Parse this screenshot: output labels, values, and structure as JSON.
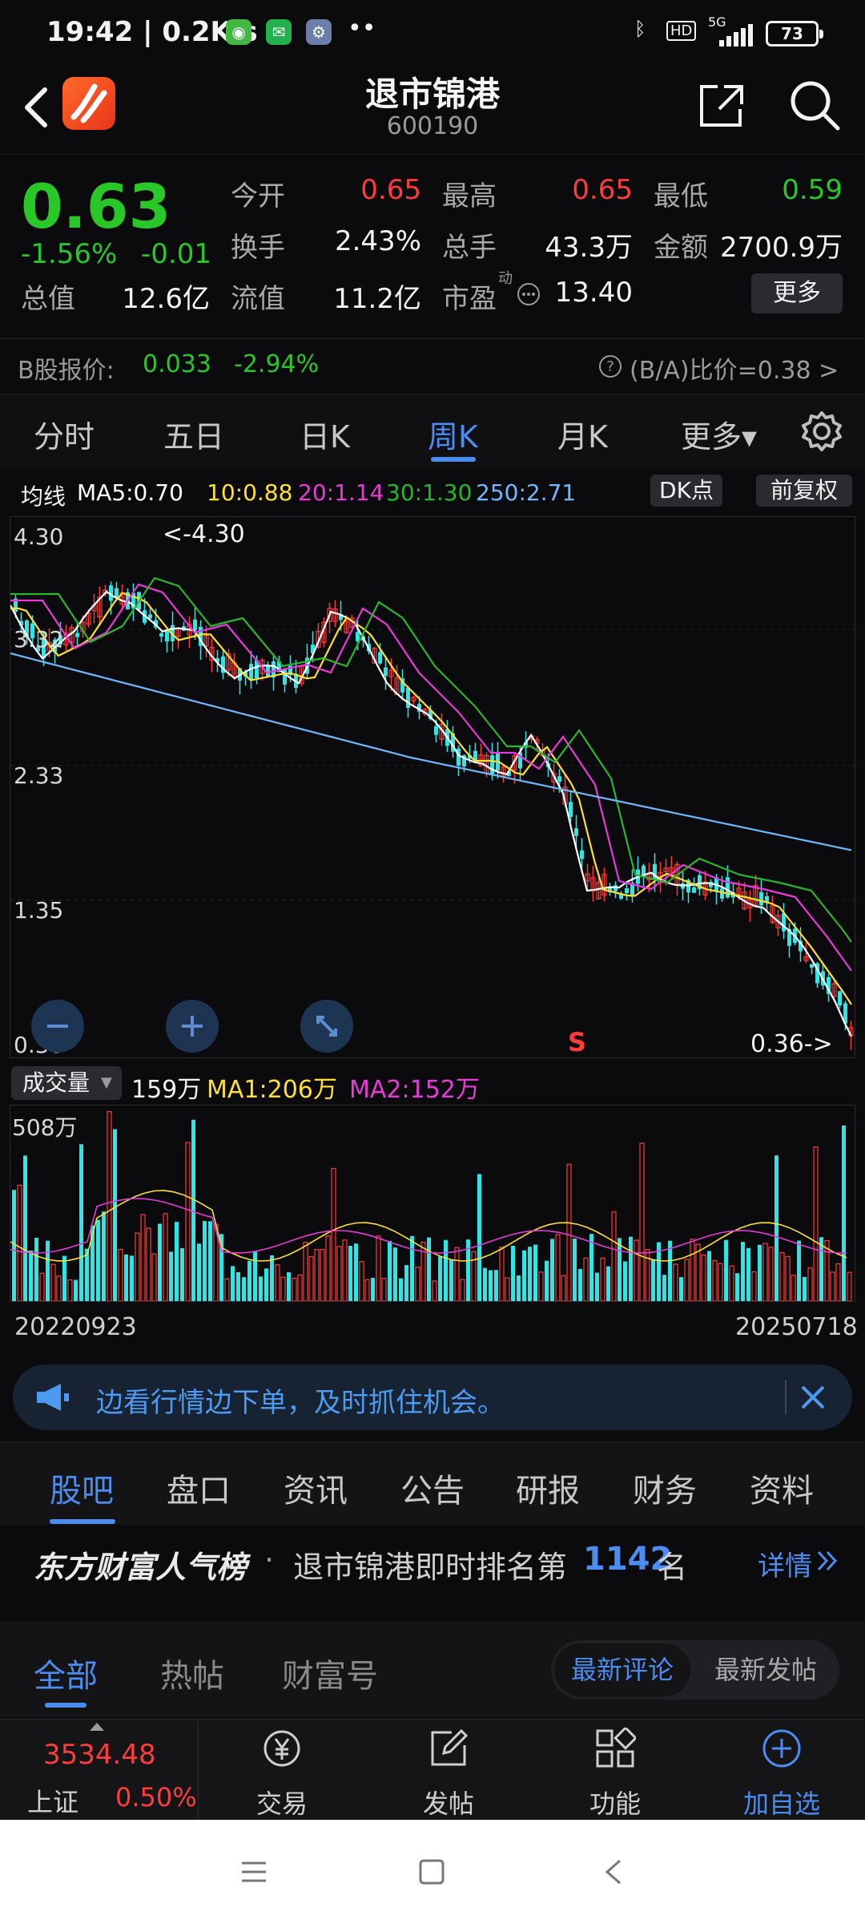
{
  "status_bar": {
    "time": "19:42 | 0.2K/s",
    "network": "5G",
    "battery": "73",
    "hd": "HD"
  },
  "header": {
    "title": "退市锦港",
    "code": "600190"
  },
  "quote": {
    "price": "0.63",
    "change_pct": "-1.56%",
    "change": "-0.01",
    "open_label": "今开",
    "open": "0.65",
    "high_label": "最高",
    "high": "0.65",
    "low_label": "最低",
    "low": "0.59",
    "turnover_label": "换手",
    "turnover": "2.43%",
    "volume_label": "总手",
    "volume": "43.3万",
    "amount_label": "金额",
    "amount": "2700.9万",
    "mktcap_label": "总值",
    "mktcap": "12.6亿",
    "float_label": "流值",
    "float_cap": "11.2亿",
    "pe_label": "市盈",
    "pe_sup": "动",
    "pe": "13.40",
    "more_button": "更多"
  },
  "b_share": {
    "label": "B股报价:",
    "price": "0.033",
    "change": "-2.94%",
    "ratio": "(B/A)比价=0.38 >"
  },
  "chart_tabs": [
    "分时",
    "五日",
    "日K",
    "周K",
    "月K",
    "更多▾"
  ],
  "active_chart_tab": "周K",
  "ma_legend": {
    "title": "均线",
    "ma5": "MA5:0.70",
    "ma10": "10:0.88",
    "ma20": "20:1.14",
    "ma30": "30:1.30",
    "ma250": "250:2.71",
    "dk_button": "DK点",
    "adjust_button": "前复权"
  },
  "kline": {
    "y_labels": [
      "4.30",
      "3.32",
      "2.33",
      "1.35",
      "0.36"
    ],
    "max_marker": "<-4.30",
    "min_marker": "0.36->",
    "signal": "S"
  },
  "volume": {
    "selector": "成交量",
    "current": "159万",
    "ma1": "MA1:206万",
    "ma2": "MA2:152万",
    "y_label": "508万",
    "date_start": "20220923",
    "date_end": "20250718"
  },
  "banner": {
    "text": "边看行情边下单，及时抓住机会。"
  },
  "info_tabs": [
    "股吧",
    "盘口",
    "资讯",
    "公告",
    "研报",
    "财务",
    "资料"
  ],
  "rank": {
    "brand": "东方财富人气榜",
    "dot": "·",
    "text": "退市锦港即时排名第",
    "number": "1142",
    "unit": "名",
    "detail": "详情"
  },
  "post_tabs": [
    "全部",
    "热帖",
    "财富号"
  ],
  "post_sort": {
    "latest_comment": "最新评论",
    "latest_post": "最新发帖"
  },
  "bottom_bar": {
    "index_value": "3534.48",
    "index_name": "上证",
    "index_change": "0.50%",
    "trade": "交易",
    "post": "发帖",
    "functions": "功能",
    "add_watch": "加自选"
  },
  "colors": {
    "up": "#ff3b3b",
    "down": "#28c828",
    "accent": "#4a8cf0",
    "ma5": "#ffffff",
    "ma10": "#ffe02e",
    "ma20": "#e83ad8",
    "ma30": "#2ab52a",
    "ma250": "#6fb8ff"
  }
}
